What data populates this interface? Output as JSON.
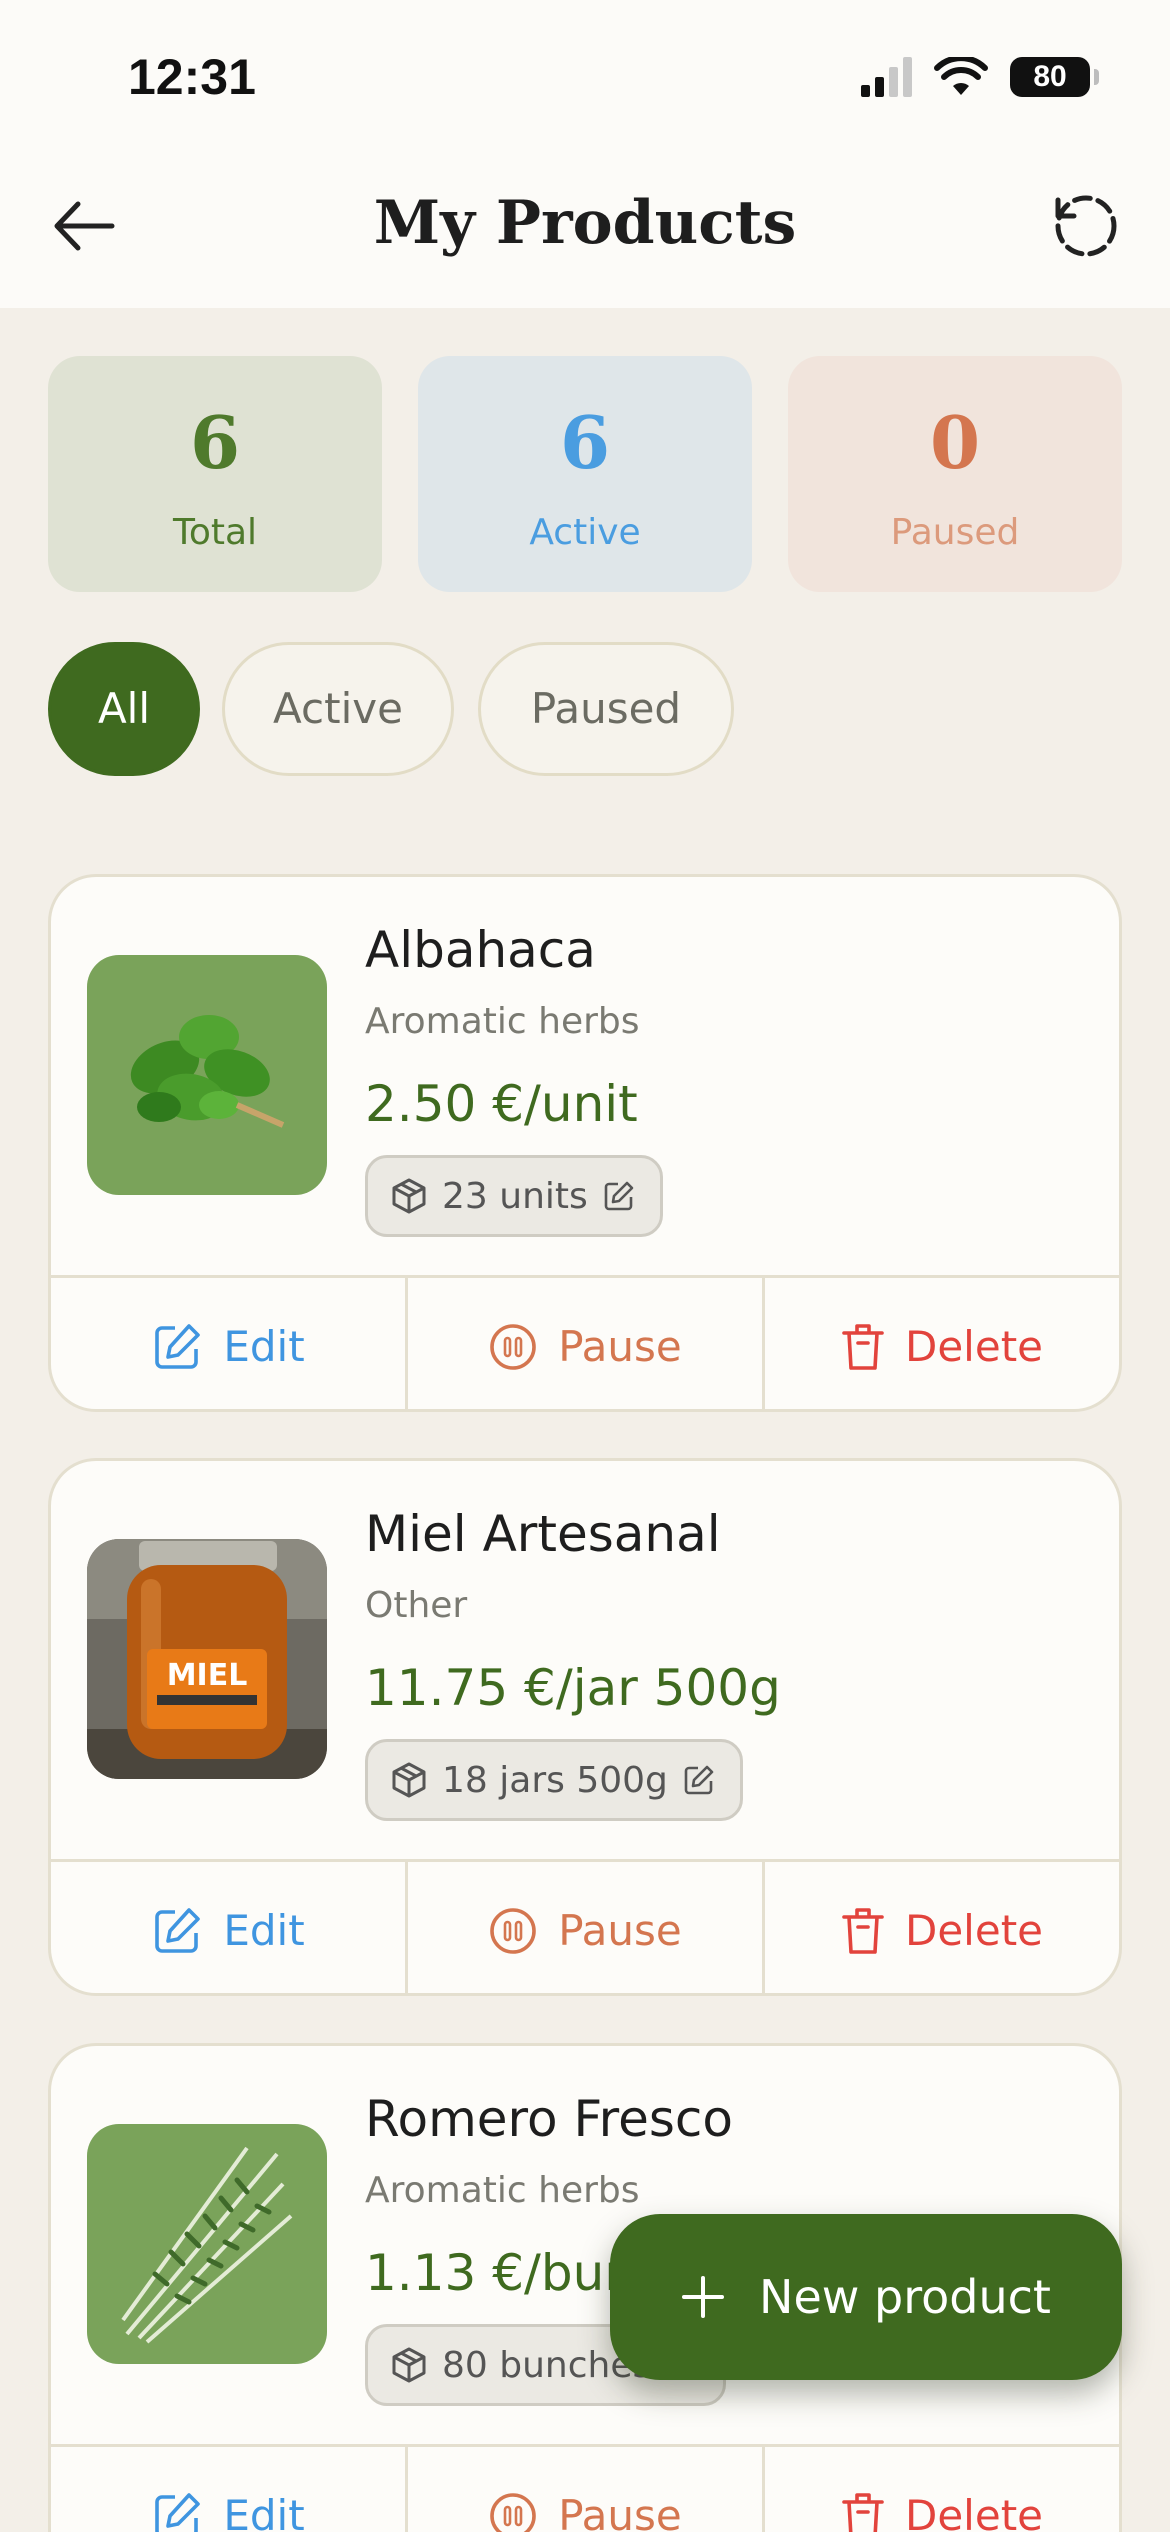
{
  "status_bar": {
    "time": "12:31",
    "battery": "80"
  },
  "header": {
    "title": "My Products"
  },
  "stats": [
    {
      "value": "6",
      "label": "Total"
    },
    {
      "value": "6",
      "label": "Active"
    },
    {
      "value": "0",
      "label": "Paused"
    }
  ],
  "filters": [
    {
      "label": "All",
      "selected": true
    },
    {
      "label": "Active",
      "selected": false
    },
    {
      "label": "Paused",
      "selected": false
    }
  ],
  "products": [
    {
      "name": "Albahaca",
      "category": "Aromatic herbs",
      "price": "2.50 €/unit",
      "stock": "23 units"
    },
    {
      "name": "Miel Artesanal",
      "category": "Other",
      "price": "11.75 €/jar 500g",
      "stock": "18 jars 500g"
    },
    {
      "name": "Romero Fresco",
      "category": "Aromatic herbs",
      "price": "1.13 €/bunch",
      "stock": "80 bunches"
    }
  ],
  "actions": {
    "edit": "Edit",
    "pause": "Pause",
    "delete": "Delete"
  },
  "fab": {
    "label": "New product"
  },
  "colors": {
    "primary": "#3f6a1f",
    "edit": "#3f95e0",
    "pause": "#d4764f",
    "delete": "#e2433c",
    "background": "#f3efe8"
  },
  "icons": {
    "back": "arrow-left-icon",
    "refresh": "refresh-icon",
    "stock": "box-icon",
    "stock_edit": "pencil-icon",
    "edit": "edit-icon",
    "pause": "pause-circle-icon",
    "delete": "trash-icon",
    "fab": "plus-icon"
  }
}
